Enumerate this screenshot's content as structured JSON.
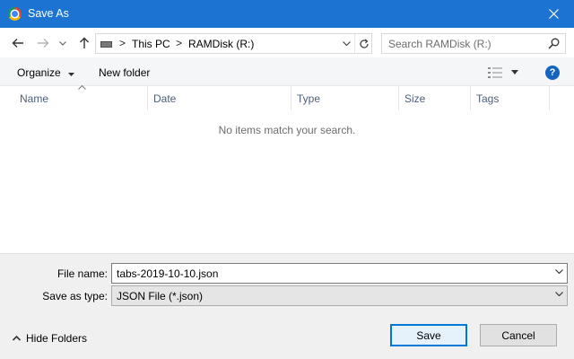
{
  "window": {
    "title": "Save As",
    "close_icon": "close-icon",
    "app_icon": "chrome-icon"
  },
  "nav": {
    "back_icon": "back-arrow-icon",
    "forward_icon": "forward-arrow-icon",
    "recent_icon": "chevron-down-icon",
    "up_icon": "up-arrow-icon"
  },
  "address": {
    "crumbs": [
      "This PC",
      "RAMDisk (R:)"
    ],
    "separator": ">",
    "refresh_icon": "refresh-icon"
  },
  "search": {
    "placeholder": "Search RAMDisk (R:)"
  },
  "toolbar": {
    "organize": "Organize",
    "new_folder": "New folder",
    "help": "?"
  },
  "columns": [
    "Name",
    "Date",
    "Type",
    "Size",
    "Tags"
  ],
  "file_list": {
    "empty_message": "No items match your search."
  },
  "form": {
    "file_name_label": "File name:",
    "file_name_value": "tabs-2019-10-10.json",
    "save_type_label": "Save as type:",
    "save_type_value": "JSON File (*.json)"
  },
  "footer": {
    "hide_folders": "Hide Folders",
    "save": "Save",
    "cancel": "Cancel"
  },
  "colors": {
    "titlebar": "#1d73d1",
    "accent": "#0078d7",
    "column_text": "#4c607a"
  }
}
